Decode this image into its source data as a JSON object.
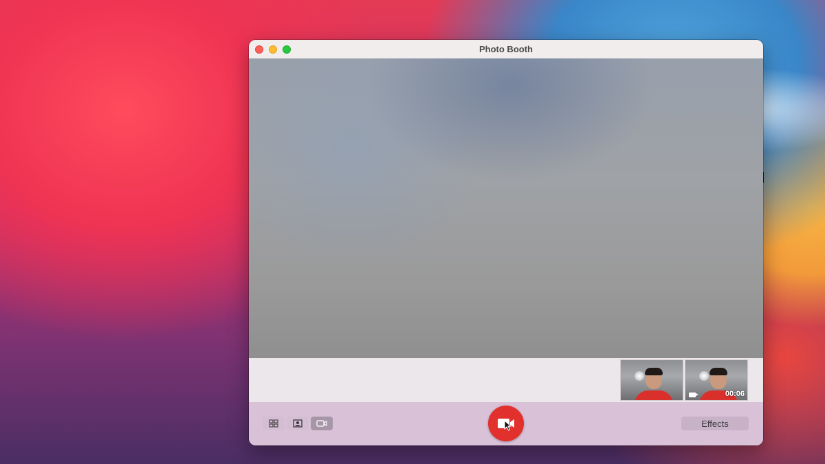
{
  "window": {
    "title": "Photo Booth"
  },
  "thumbnails": [
    {
      "kind": "photo"
    },
    {
      "kind": "video",
      "duration": "00:06"
    }
  ],
  "toolbar": {
    "modes": [
      {
        "icon": "four-up-grid-icon",
        "active": false
      },
      {
        "icon": "single-photo-icon",
        "active": false
      },
      {
        "icon": "video-clip-icon",
        "active": true
      }
    ],
    "shutter_icon": "video-camera-icon",
    "effects_label": "Effects"
  },
  "colors": {
    "toolbar_bg": "#d9c1d8",
    "shutter": "#e2302c",
    "active_mode": "#a796a8"
  }
}
